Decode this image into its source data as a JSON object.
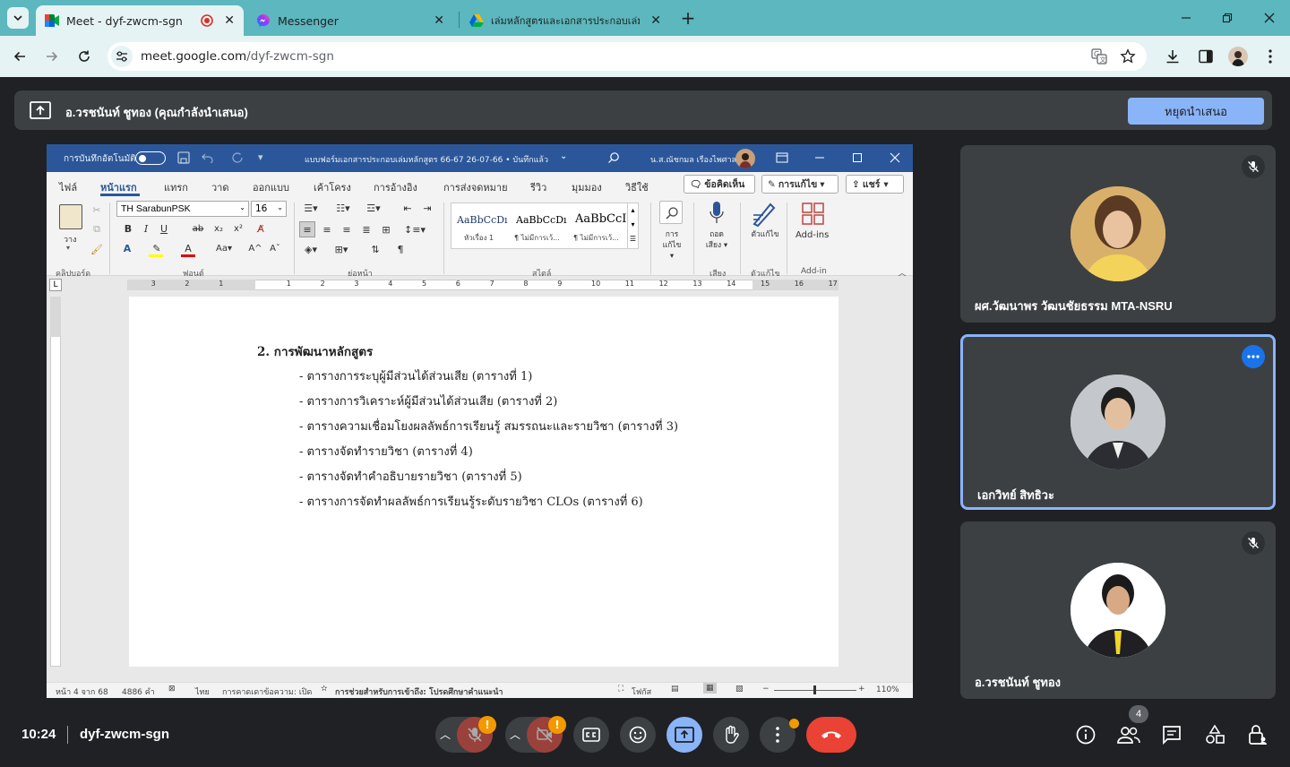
{
  "browser": {
    "tabs": [
      {
        "title": "Meet - dyf-zwcm-sgn"
      },
      {
        "title": "Messenger"
      },
      {
        "title": "เล่มหลักสูตรและเอกสารประกอบเล่มหลักสูตร"
      }
    ],
    "url_host": "meet.google.com",
    "url_path": "/dyf-zwcm-sgn"
  },
  "presenting": {
    "label": "อ.วรชนันท์ ชูทอง (คุณกำลังนำเสนอ)",
    "stop_button": "หยุดนำเสนอ"
  },
  "word": {
    "autosave": "การบันทึกอัตโนมัติ",
    "doc_title": "แบบฟอร์มเอกสารประกอบเล่มหลักสูตร 66-67 26-07-66 • บันทึกแล้ว",
    "user": "น.ส.ณัชกมล เรืองไพศาล",
    "tabs": [
      "ไฟล์",
      "หน้าแรก",
      "แทรก",
      "วาด",
      "ออกแบบ",
      "เค้าโครง",
      "การอ้างอิง",
      "การส่งจดหมาย",
      "รีวิว",
      "มุมมอง",
      "วิธีใช้"
    ],
    "comments_btn": "ข้อคิดเห็น",
    "editing_btn": "การแก้ไข",
    "share_btn": "แชร์",
    "font_name": "TH SarabunPSK",
    "font_size": "16",
    "paste_label": "วาง",
    "styles": [
      {
        "sample": "AaBbCcDı",
        "name": "หัวเรื่อง 1"
      },
      {
        "sample": "AaBbCcDı",
        "name": "¶ ไม่มีการเว้..."
      },
      {
        "sample": "AaBbCcI",
        "name": "¶ ไม่มีการเว้..."
      }
    ],
    "find_label": "การแก้ไข",
    "dictate_label": "ถอดเสียง",
    "editor_label": "ตัวแก้ไข",
    "addins_label": "Add-ins",
    "groups": [
      "คลิปบอร์ด",
      "ฟอนต์",
      "ย่อหน้า",
      "สไตล์",
      "เสียง",
      "ตัวแก้ไข",
      "Add-in"
    ],
    "ruler": [
      "3",
      "2",
      "1",
      "1",
      "2",
      "3",
      "4",
      "5",
      "6",
      "7",
      "8",
      "9",
      "10",
      "11",
      "12",
      "13",
      "14",
      "15",
      "16",
      "17"
    ],
    "document": {
      "heading": "2. การพัฒนาหลักสูตร",
      "items": [
        "- ตารางการระบุผู้มีส่วนได้ส่วนเสีย (ตารางที่ 1)",
        "- ตารางการวิเคราะห์ผู้มีส่วนได้ส่วนเสีย (ตารางที่ 2)",
        "- ตารางความเชื่อมโยงผลลัพธ์การเรียนรู้ สมรรถนะและรายวิชา (ตารางที่ 3)",
        "- ตารางจัดทำรายวิชา (ตารางที่ 4)",
        "- ตารางจัดทำคำอธิบายรายวิชา (ตารางที่ 5)",
        "- ตารางการจัดทำผลลัพธ์การเรียนรู้ระดับรายวิชา CLOs (ตารางที่ 6)"
      ]
    },
    "status": {
      "page": "หน้า 4 จาก 68",
      "words": "4886 คำ",
      "language": "ไทย",
      "prediction": "การคาดเดาข้อความ: เปิด",
      "accessibility": "การช่วยสำหรับการเข้าถึง: โปรดศึกษาคำแนะนำ",
      "focus": "โฟกัส",
      "zoom": "110%"
    }
  },
  "participants": [
    {
      "name": "ผศ.วัฒนาพร วัฒนชัยธรรม MTA-NSRU",
      "muted": true
    },
    {
      "name": "เอกวิทย์ สิทธิวะ",
      "muted": false
    },
    {
      "name": "อ.วรชนันท์ ชูทอง",
      "muted": true
    }
  ],
  "bottom": {
    "time": "10:24",
    "meeting_code": "dyf-zwcm-sgn",
    "people_count": "4"
  },
  "colors": {
    "tab_bar": "#5cb7be",
    "word_blue": "#2b579a",
    "stop_button": "#8ab4f8",
    "end_call": "#ea4335",
    "present_active": "#8ab4f8"
  }
}
